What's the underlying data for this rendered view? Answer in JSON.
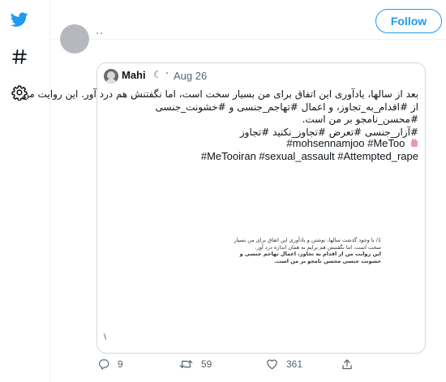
{
  "sidebar": {
    "items": [
      {
        "icon": "twitter-bird-icon"
      },
      {
        "icon": "hashtag-icon"
      },
      {
        "icon": "gear-icon"
      }
    ]
  },
  "header": {
    "follow_label": "Follow"
  },
  "quoted_tweet": {
    "author_name": "Mahi",
    "name_emoji": "☾",
    "separator": "·",
    "date": "Aug 26",
    "text_lines": [
      "بعد از سالها، یادآوری این اتفاق برای من بسیار سخت است، اما نگفتنش هم درد آور. این روایت من",
      "از #اقدام_به_تجاوز، و اعمال #تهاجم_جنسی و #خشونت_جنسی",
      "#محسن_نامجو بر من است.",
      "#آزار_جنسی #تعرض #تجاوز_نکنید #تجاوز"
    ],
    "hashtags_line": "#mohsennamjoo  #MeToo",
    "hashtags_line2": "#MeTooiran #sexual_assault #Attempted_rape",
    "media": {
      "lines": [
        "1/ با وجود گذشت سالها، نوشتن و یادآوری این اتفاق برای من بسیار",
        "سخت است، اما نگفتنش هم برایم به همان اندازه درد آور.",
        "این روایت من از اقدام به تجاوز، اعمال تهاجم جنسی و",
        "خشونت جنسی محسن نامجو بر من است."
      ],
      "mark": "\\"
    }
  },
  "actions": {
    "replies": "9",
    "retweets": "59",
    "likes": "361"
  },
  "colors": {
    "accent": "#1d9bf0",
    "muted": "#536471",
    "border": "#cfd9de"
  }
}
